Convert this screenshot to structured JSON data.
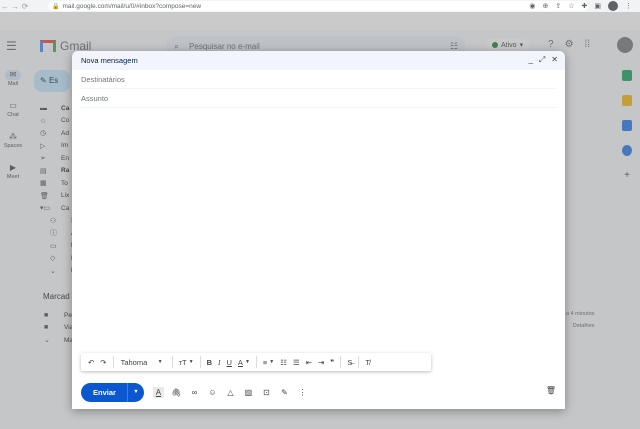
{
  "browser": {
    "url": "mail.google.com/mail/u/0/#inbox?compose=new",
    "back_icon": "arrow-left-icon",
    "forward_icon": "arrow-right-icon",
    "reload_icon": "reload-icon"
  },
  "gmail": {
    "logo_text": "Gmail",
    "search_placeholder": "Pesquisar no e-mail",
    "status": "Ativo",
    "rail": [
      {
        "label": "Mail"
      },
      {
        "label": "Chat"
      },
      {
        "label": "Spaces"
      },
      {
        "label": "Meet"
      }
    ],
    "compose_label": "Es",
    "folders": [
      "Ca",
      "Co",
      "Ad",
      "Im",
      "En",
      "Ra",
      "To",
      "Lix",
      "Ca",
      "S",
      "A",
      "F",
      "P",
      "Ma"
    ],
    "labels_title": "Marcad",
    "labels": [
      "Pe",
      "Via",
      "Ma"
    ],
    "time_note_1": "a 4 minutos",
    "time_note_2": "Detalhes",
    "accent_color": "#0b57d0"
  },
  "compose": {
    "title": "Nova mensagem",
    "to_placeholder": "Destinatários",
    "subject_placeholder": "Assunto",
    "font_name": "Tahoma",
    "send_label": "Enviar",
    "toolbar": {
      "undo": "↶",
      "redo": "↷",
      "size": "ᴛT",
      "bold": "B",
      "italic": "I",
      "underline": "U",
      "text_color": "A",
      "align": "≡",
      "numbered": "☷",
      "bullets": "☰",
      "indent_less": "⇤",
      "indent_more": "⇥",
      "quote": "❞",
      "strike": "S̶",
      "clear": "T̸"
    }
  }
}
